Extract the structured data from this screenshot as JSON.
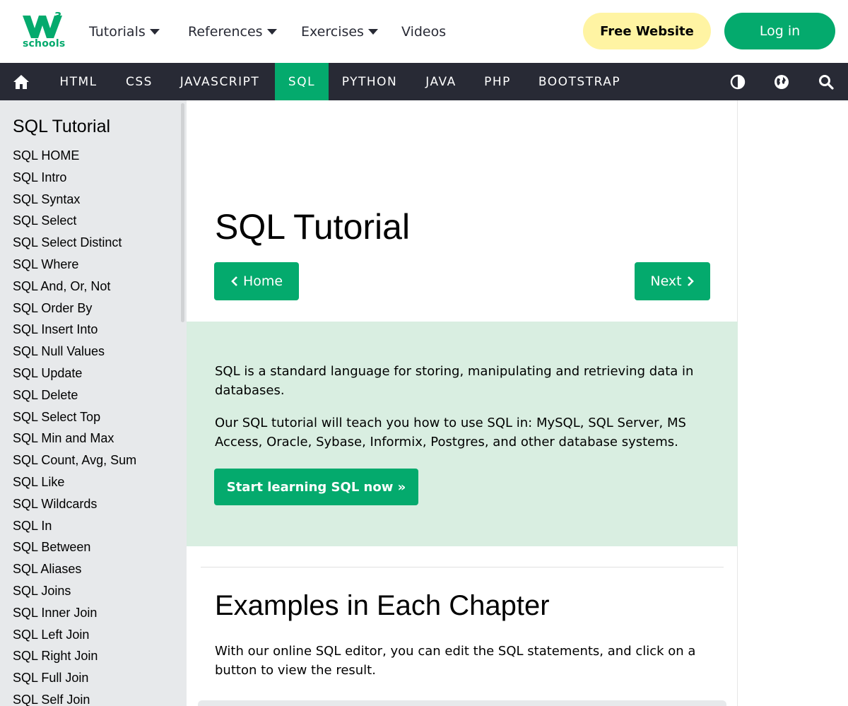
{
  "header": {
    "logo_sup": "3",
    "logo_text": "schools",
    "nav": [
      {
        "label": "Tutorials",
        "has_caret": true
      },
      {
        "label": "References",
        "has_caret": true
      },
      {
        "label": "Exercises",
        "has_caret": true
      },
      {
        "label": "Videos",
        "has_caret": false
      }
    ],
    "free_website": "Free Website",
    "login": "Log in"
  },
  "topnav": {
    "home_icon": "home-icon",
    "items": [
      "HTML",
      "CSS",
      "JAVASCRIPT",
      "SQL",
      "PYTHON",
      "JAVA",
      "PHP",
      "BOOTSTRAP"
    ],
    "active": "SQL",
    "right_icons": [
      "contrast-icon",
      "globe-icon",
      "search-icon"
    ]
  },
  "sidebar": {
    "title": "SQL Tutorial",
    "items": [
      "SQL HOME",
      "SQL Intro",
      "SQL Syntax",
      "SQL Select",
      "SQL Select Distinct",
      "SQL Where",
      "SQL And, Or, Not",
      "SQL Order By",
      "SQL Insert Into",
      "SQL Null Values",
      "SQL Update",
      "SQL Delete",
      "SQL Select Top",
      "SQL Min and Max",
      "SQL Count, Avg, Sum",
      "SQL Like",
      "SQL Wildcards",
      "SQL In",
      "SQL Between",
      "SQL Aliases",
      "SQL Joins",
      "SQL Inner Join",
      "SQL Left Join",
      "SQL Right Join",
      "SQL Full Join",
      "SQL Self Join"
    ]
  },
  "main": {
    "title": "SQL Tutorial",
    "prev_button": "Home",
    "next_button": "Next",
    "intro_p1": "SQL is a standard language for storing, manipulating and retrieving data in databases.",
    "intro_p2": "Our SQL tutorial will teach you how to use SQL in: MySQL, SQL Server, MS Access, Oracle, Sybase, Informix, Postgres, and other database systems.",
    "start_button": "Start learning SQL now »",
    "examples_heading": "Examples in Each Chapter",
    "examples_p": "With our online SQL editor, you can edit the SQL statements, and click on a button to view the result."
  },
  "colors": {
    "brand_green": "#04aa6d",
    "nav_dark": "#282a35",
    "free_yellow": "#fff4a3",
    "intro_bg": "#d9eee1",
    "sidebar_bg": "#e7e9eb"
  }
}
